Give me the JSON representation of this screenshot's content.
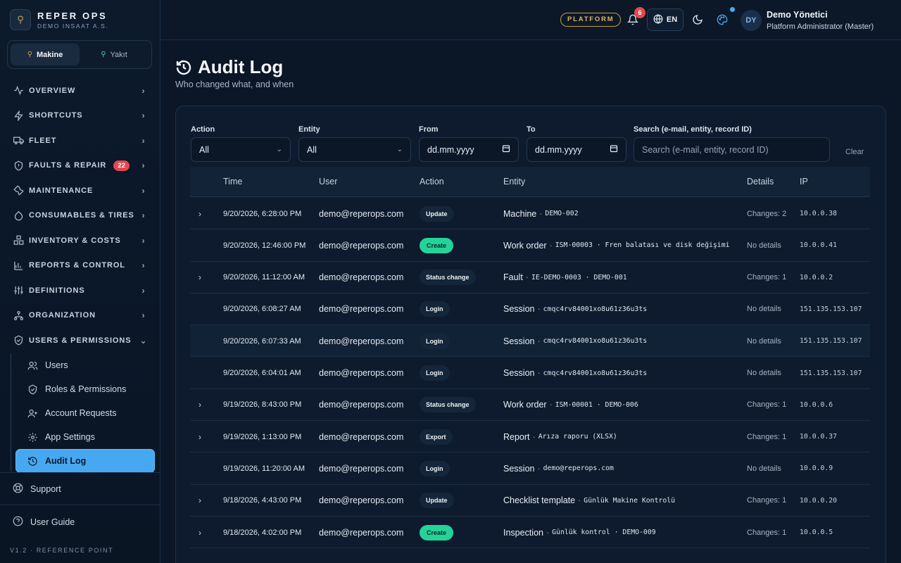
{
  "brand": {
    "name": "REPER OPS",
    "sub": "DEMO INSAAT A.S."
  },
  "segment": {
    "items": [
      {
        "label": "Makine",
        "active": true
      },
      {
        "label": "Yakıt",
        "active": false
      }
    ]
  },
  "nav": {
    "items": [
      {
        "label": "OVERVIEW",
        "icon": "activity-icon"
      },
      {
        "label": "SHORTCUTS",
        "icon": "bolt-icon"
      },
      {
        "label": "FLEET",
        "icon": "truck-icon"
      },
      {
        "label": "FAULTS & REPAIR",
        "icon": "shield-icon",
        "badge": "22"
      },
      {
        "label": "MAINTENANCE",
        "icon": "wrench-icon"
      },
      {
        "label": "CONSUMABLES & TIRES",
        "icon": "droplet-icon"
      },
      {
        "label": "INVENTORY & COSTS",
        "icon": "boxes-icon"
      },
      {
        "label": "REPORTS & CONTROL",
        "icon": "bar-chart-icon"
      },
      {
        "label": "DEFINITIONS",
        "icon": "sliders-icon"
      },
      {
        "label": "ORGANIZATION",
        "icon": "org-chart-icon"
      },
      {
        "label": "USERS & PERMISSIONS",
        "icon": "user-shield-icon",
        "expanded": true
      }
    ],
    "sub_items": [
      {
        "label": "Users",
        "icon": "users-icon"
      },
      {
        "label": "Roles & Permissions",
        "icon": "shield-check-icon"
      },
      {
        "label": "Account Requests",
        "icon": "user-plus-icon"
      },
      {
        "label": "App Settings",
        "icon": "gear-icon"
      },
      {
        "label": "Audit Log",
        "icon": "history-icon",
        "active": true
      }
    ],
    "support": "Support",
    "guide": "User Guide",
    "version": "V1.2 · REFERENCE POINT"
  },
  "topbar": {
    "platform": "PLATFORM",
    "notifications": "6",
    "language": "EN",
    "avatar": "DY",
    "user_name": "Demo Yönetici",
    "user_role": "Platform Administrator (Master)"
  },
  "page": {
    "title": "Audit Log",
    "subtitle": "Who changed what, and when"
  },
  "filters": {
    "action_label": "Action",
    "action_value": "All",
    "entity_label": "Entity",
    "entity_value": "All",
    "from_label": "From",
    "from_value": "dd.mm.yyyy",
    "to_label": "To",
    "to_value": "dd.mm.yyyy",
    "search_label": "Search (e-mail, entity, record ID)",
    "search_placeholder": "Search (e-mail, entity, record ID)",
    "clear": "Clear"
  },
  "table": {
    "headers": {
      "time": "Time",
      "user": "User",
      "action": "Action",
      "entity": "Entity",
      "details": "Details",
      "ip": "IP"
    },
    "rows": [
      {
        "expandable": true,
        "time": "9/20/2026, 6:28:00 PM",
        "user": "demo@reperops.com",
        "action": "Update",
        "action_kind": "neutral",
        "entity": "Machine",
        "ref": "DEMO-002",
        "details": "Changes: 2",
        "ip": "10.0.0.38"
      },
      {
        "expandable": false,
        "time": "9/20/2026, 12:46:00 PM",
        "user": "demo@reperops.com",
        "action": "Create",
        "action_kind": "create",
        "entity": "Work order",
        "ref": "ISM-00003 · Fren balatası ve disk değişimi",
        "details": "No details",
        "ip": "10.0.0.41"
      },
      {
        "expandable": true,
        "time": "9/20/2026, 11:12:00 AM",
        "user": "demo@reperops.com",
        "action": "Status change",
        "action_kind": "neutral",
        "entity": "Fault",
        "ref": "IE-DEMO-0003 · DEMO-001",
        "details": "Changes: 1",
        "ip": "10.0.0.2"
      },
      {
        "expandable": false,
        "time": "9/20/2026, 6:08:27 AM",
        "user": "demo@reperops.com",
        "action": "Login",
        "action_kind": "neutral",
        "entity": "Session",
        "ref": "cmqc4rv84001xo8u61z36u3ts",
        "details": "No details",
        "ip": "151.135.153.107"
      },
      {
        "expandable": false,
        "time": "9/20/2026, 6:07:33 AM",
        "user": "demo@reperops.com",
        "action": "Login",
        "action_kind": "neutral",
        "entity": "Session",
        "ref": "cmqc4rv84001xo8u61z36u3ts",
        "details": "No details",
        "ip": "151.135.153.107",
        "highlight": true
      },
      {
        "expandable": false,
        "time": "9/20/2026, 6:04:01 AM",
        "user": "demo@reperops.com",
        "action": "Login",
        "action_kind": "neutral",
        "entity": "Session",
        "ref": "cmqc4rv84001xo8u61z36u3ts",
        "details": "No details",
        "ip": "151.135.153.107"
      },
      {
        "expandable": true,
        "time": "9/19/2026, 8:43:00 PM",
        "user": "demo@reperops.com",
        "action": "Status change",
        "action_kind": "neutral",
        "entity": "Work order",
        "ref": "ISM-00001 · DEMO-006",
        "details": "Changes: 1",
        "ip": "10.0.0.6"
      },
      {
        "expandable": true,
        "time": "9/19/2026, 1:13:00 PM",
        "user": "demo@reperops.com",
        "action": "Export",
        "action_kind": "neutral",
        "entity": "Report",
        "ref": "Arıza raporu (XLSX)",
        "details": "Changes: 1",
        "ip": "10.0.0.37"
      },
      {
        "expandable": false,
        "time": "9/19/2026, 11:20:00 AM",
        "user": "demo@reperops.com",
        "action": "Login",
        "action_kind": "neutral",
        "entity": "Session",
        "ref": "demo@reperops.com",
        "details": "No details",
        "ip": "10.0.0.9"
      },
      {
        "expandable": true,
        "time": "9/18/2026, 4:43:00 PM",
        "user": "demo@reperops.com",
        "action": "Update",
        "action_kind": "neutral",
        "entity": "Checklist template",
        "ref": "Günlük Makine Kontrolü",
        "details": "Changes: 1",
        "ip": "10.0.0.20"
      },
      {
        "expandable": true,
        "time": "9/18/2026, 4:02:00 PM",
        "user": "demo@reperops.com",
        "action": "Create",
        "action_kind": "create",
        "entity": "Inspection",
        "ref": "Günlük kontrol · DEMO-009",
        "details": "Changes: 1",
        "ip": "10.0.0.5"
      }
    ]
  }
}
